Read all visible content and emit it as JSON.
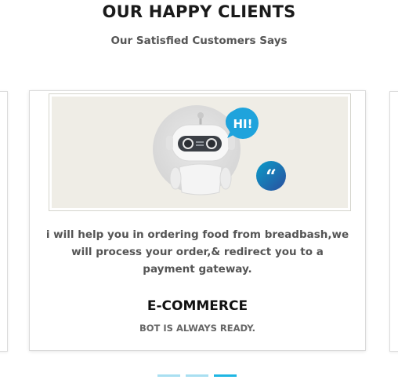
{
  "section": {
    "title": "OUR HAPPY CLIENTS",
    "subtitle": "Our Satisfied Customers Says"
  },
  "testimonial": {
    "speech_bubble": "HI!",
    "quote": "i will help you in ordering food from breadbash,we will process your order,& redirect you to a payment gateway.",
    "name": "E-COMMERCE",
    "role": "BOT IS ALWAYS READY.",
    "image_icon": "robot-icon",
    "quote_icon": "quote-icon"
  },
  "carousel": {
    "slide_count": 3,
    "active_index": 2
  },
  "colors": {
    "accent": "#1fb6e3",
    "accent_light": "#a9dff1",
    "hero_bg": "#efede6"
  }
}
